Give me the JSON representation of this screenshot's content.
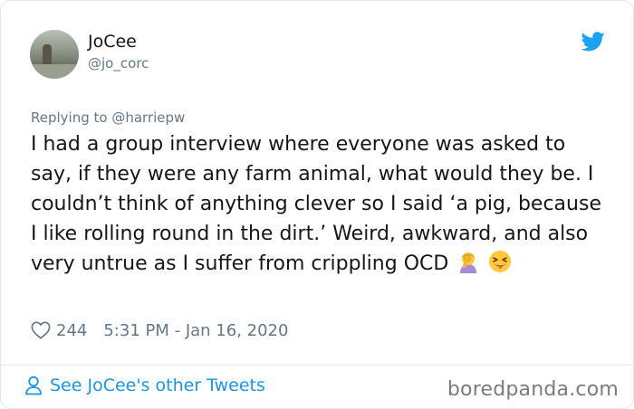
{
  "author": {
    "name": "JoCee",
    "handle": "@jo_corc"
  },
  "reply": {
    "prefix": "Replying to ",
    "to_handle": "@harriepw"
  },
  "tweet": {
    "text": "I had a group interview where everyone was asked to say, if they were any farm animal, what would they be. I couldn’t think of anything clever so I said ‘a pig, because I like rolling round in the dirt.’ Weird, awkward, and also very untrue as I suffer from crippling OCD"
  },
  "meta": {
    "likes": "244",
    "timestamp": "5:31 PM - Jan 16, 2020"
  },
  "footer": {
    "see_more": "See JoCee's other Tweets"
  },
  "watermark": "boredpanda.com",
  "colors": {
    "link_blue": "#1b95e0",
    "twitter_blue": "#1da1f2",
    "secondary_text": "#657786",
    "border": "#e1e8ed"
  },
  "icons": [
    "twitter-bird-icon",
    "heart-icon",
    "person-icon",
    "facepalm-emoji-icon",
    "squinting-tongue-emoji-icon"
  ]
}
